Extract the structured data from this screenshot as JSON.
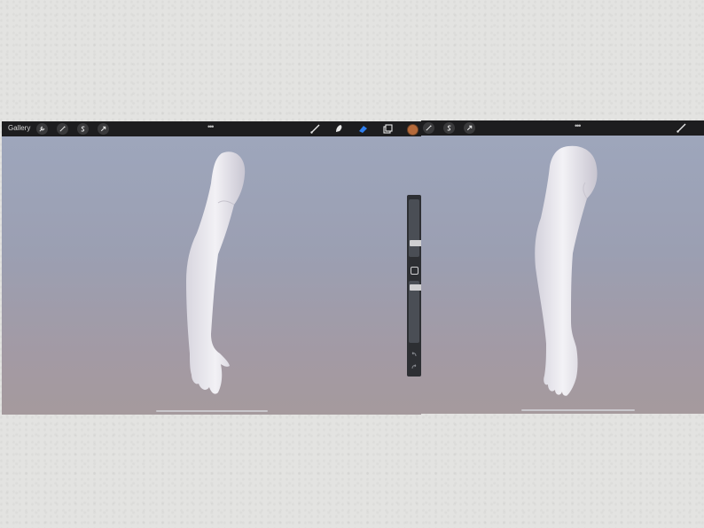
{
  "left_screen": {
    "topbar": {
      "gallery_label": "Gallery",
      "tools_left": [
        "wrench-icon",
        "magic-wand-icon",
        "selection-s-icon",
        "transform-arrow-icon"
      ],
      "more_dots": "•••",
      "tools_right": [
        "brush-icon",
        "smudge-icon",
        "eraser-icon",
        "layers-icon"
      ],
      "active_tool": "eraser-icon",
      "eraser_color": "#2f7ff0",
      "current_color": "#b56a3b"
    },
    "sidebar": {
      "brush_size_level": 0.35,
      "opacity_level": 0.42,
      "undo_icon": "undo-icon",
      "redo_icon": "redo-icon"
    }
  },
  "right_screen": {
    "topbar": {
      "tools_left": [
        "magic-wand-icon",
        "selection-s-icon",
        "transform-arrow-icon"
      ],
      "more_dots": "•••",
      "tools_right": [
        "brush-icon"
      ]
    }
  }
}
